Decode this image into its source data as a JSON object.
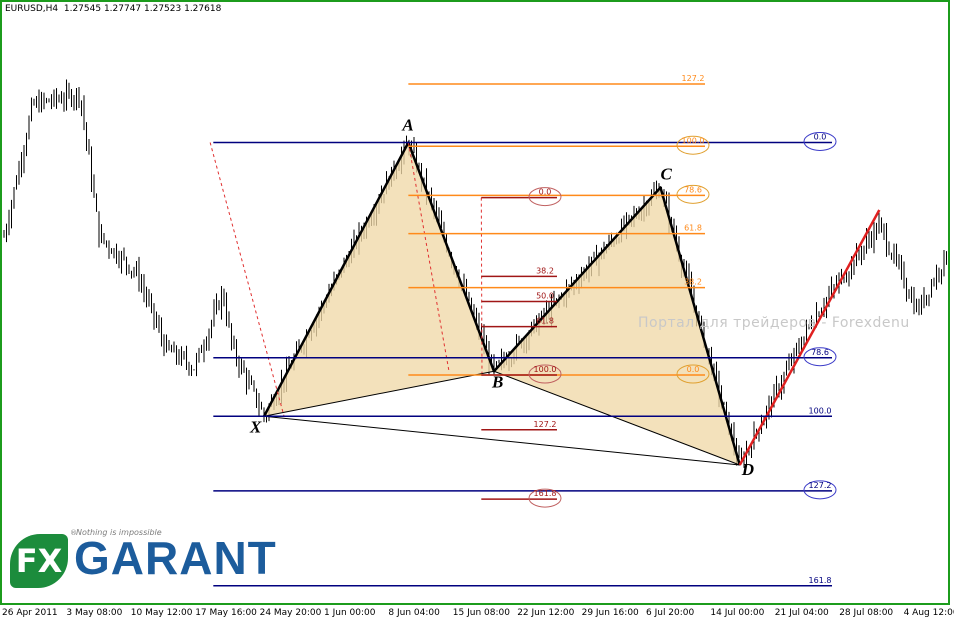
{
  "header": {
    "symbol": "EURUSD,H4",
    "ohlc": "1.27545 1.27747 1.27523 1.27618"
  },
  "watermark": "Портал для трейдеров - Forexdenu",
  "logo": {
    "fx": "FX",
    "name": "GARANT",
    "slogan": "Nothing is impossible",
    "reg": "®"
  },
  "colors": {
    "navy_level": "#00007f",
    "orange_level": "#ff8a1a",
    "darkred_level": "#a01616",
    "pattern_fill": "#f0d9a8",
    "pattern_line": "#000000",
    "projection": "#e02020",
    "frame": "#1c9c1c",
    "label_ellipse_navy": "#3a3ac8",
    "label_ellipse_orange": "#e0a030",
    "label_ellipse_darkred": "#c06060"
  },
  "chart_data": {
    "type": "line",
    "title": "EURUSD,H4",
    "instrument": "EURUSD",
    "timeframe": "H4",
    "x_tick_labels": [
      "26 Apr 2011",
      "3 May 08:00",
      "10 May 12:00",
      "17 May 16:00",
      "24 May 20:00",
      "1 Jun 00:00",
      "8 Jun 04:00",
      "15 Jun 08:00",
      "22 Jun 12:00",
      "29 Jun 16:00",
      "6 Jul 20:00",
      "14 Jul 00:00",
      "21 Jul 04:00",
      "28 Jul 08:00",
      "4 Aug 12:00"
    ],
    "pattern_points": [
      {
        "name": "X",
        "date": "2011-05-23 08:00",
        "price": 1.397
      },
      {
        "name": "A",
        "date": "2011-06-07 12:00",
        "price": 1.47
      },
      {
        "name": "B",
        "date": "2011-06-16 12:00",
        "price": 1.409
      },
      {
        "name": "C",
        "date": "2011-07-04 00:00",
        "price": 1.458
      },
      {
        "name": "D",
        "date": "2011-07-12 08:00",
        "price": 1.384
      }
    ],
    "projection": {
      "from": "2011-07-12 08:00",
      "to": "2011-07-27 00:00",
      "from_price": 1.384,
      "to_price": 1.452
    },
    "fib_XA_navy": [
      {
        "label": "0.0",
        "price": 1.47,
        "circled": true
      },
      {
        "label": "78.6",
        "price": 1.4126,
        "circled": true
      },
      {
        "label": "100.0",
        "price": 1.397,
        "circled": false
      },
      {
        "label": "127.2",
        "price": 1.3771,
        "circled": true
      },
      {
        "label": "161.8",
        "price": 1.3518,
        "circled": false
      }
    ],
    "fib_BC_orange": [
      {
        "label": "127.2",
        "price": 1.4856,
        "circled": false
      },
      {
        "label": "100.0",
        "price": 1.469,
        "circled": true
      },
      {
        "label": "78.6",
        "price": 1.4559,
        "circled": true
      },
      {
        "label": "61.8",
        "price": 1.4457,
        "circled": false
      },
      {
        "label": "38.2",
        "price": 1.4313,
        "circled": false
      },
      {
        "label": "0.0",
        "price": 1.408,
        "circled": true
      }
    ],
    "fib_AB_darkred": [
      {
        "label": "0.0",
        "price": 1.4553,
        "circled": true
      },
      {
        "label": "38.2",
        "price": 1.4343,
        "circled": false
      },
      {
        "label": "50.0",
        "price": 1.4276,
        "circled": false
      },
      {
        "label": "61.8",
        "price": 1.4209,
        "circled": false
      },
      {
        "label": "100.0",
        "price": 1.408,
        "circled": true
      },
      {
        "label": "127.2",
        "price": 1.3934,
        "circled": false
      },
      {
        "label": "161.8",
        "price": 1.3749,
        "circled": true
      }
    ],
    "price_range": [
      1.348,
      1.5
    ],
    "grid": false,
    "legend": "none"
  }
}
